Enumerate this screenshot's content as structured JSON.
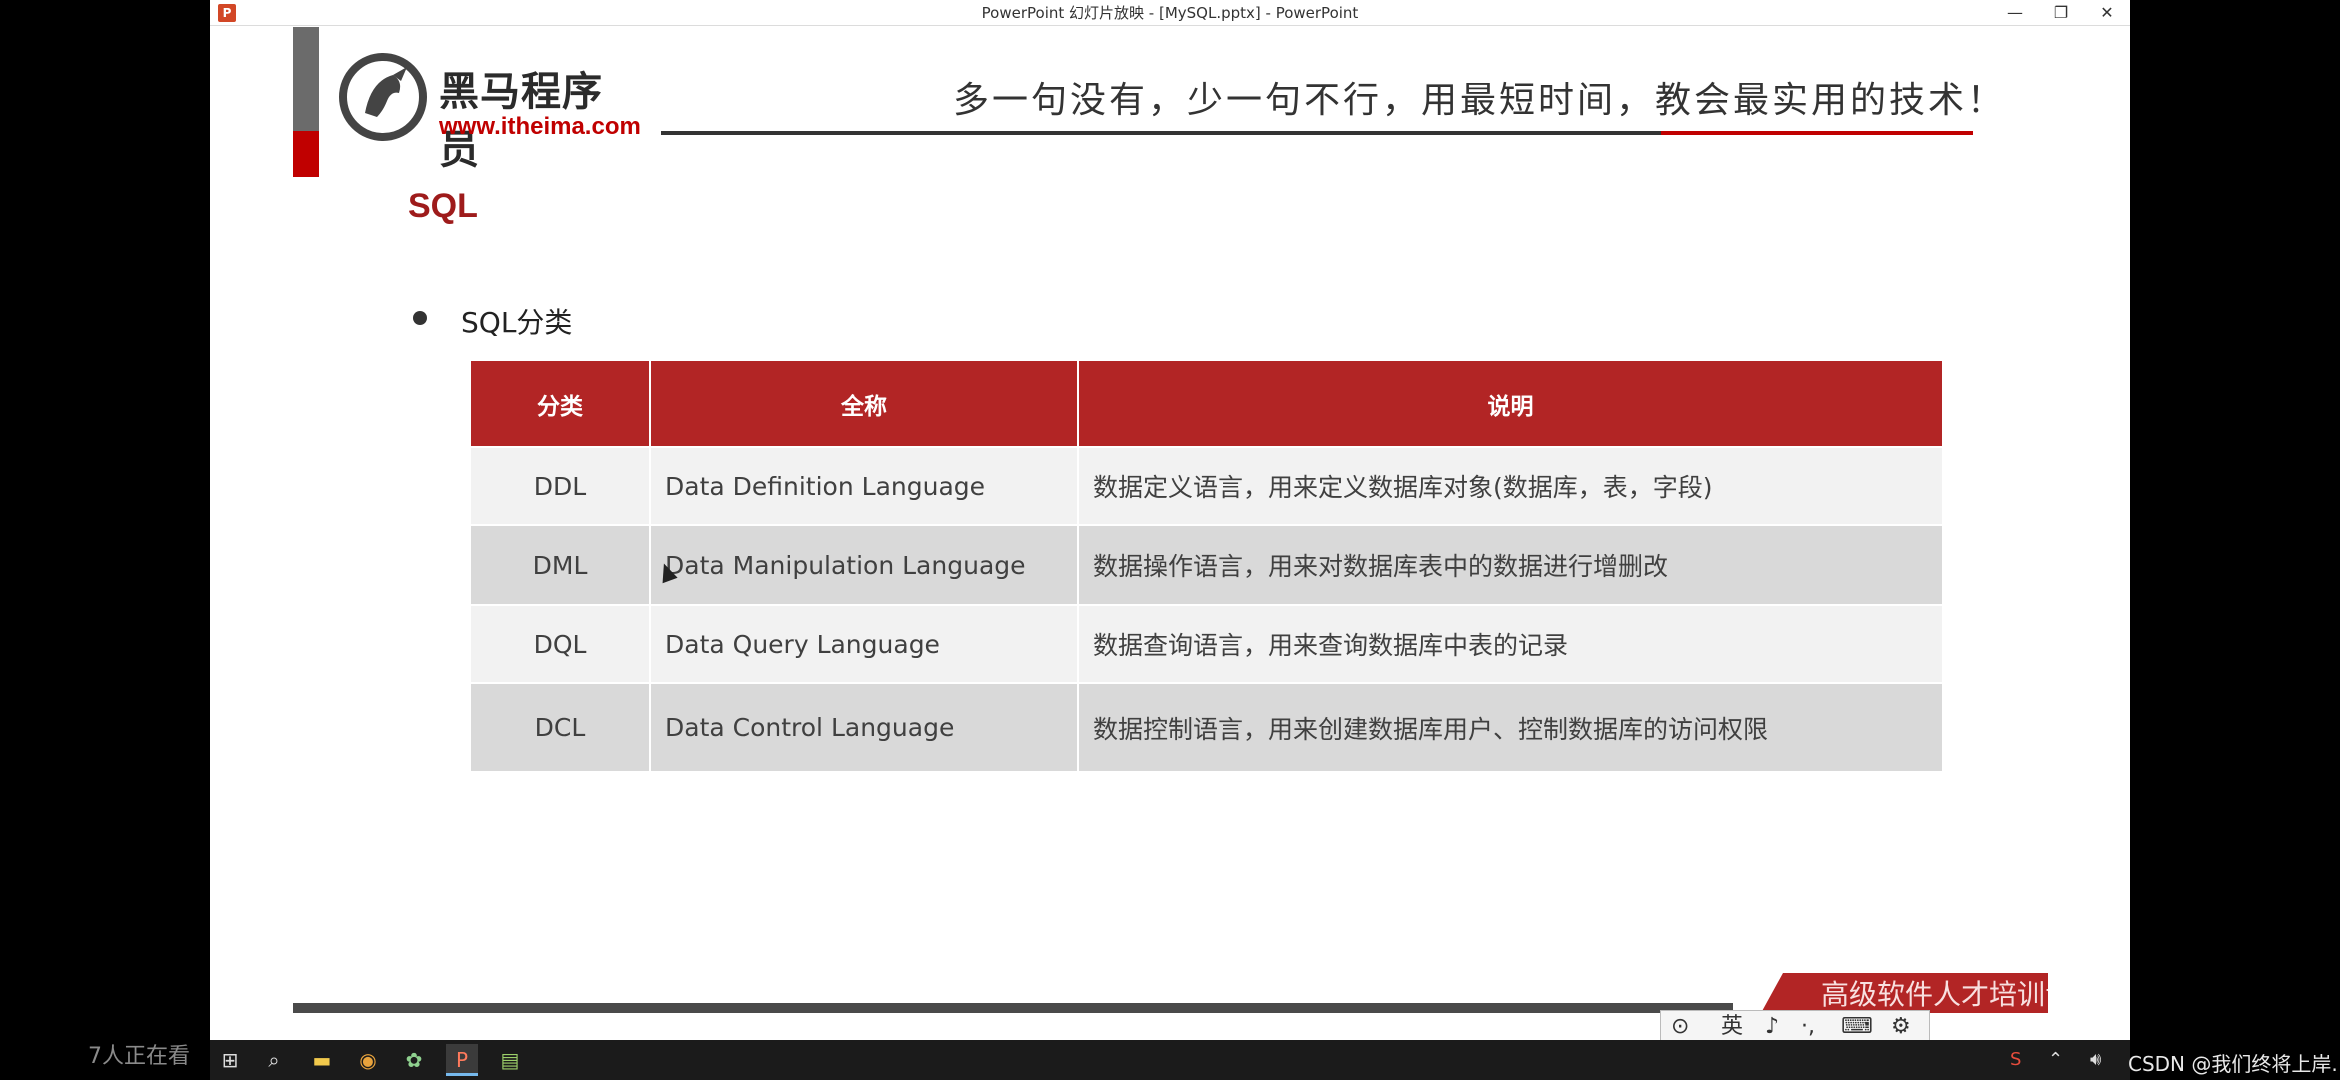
{
  "window": {
    "title": "PowerPoint 幻灯片放映 - [MySQL.pptx] - PowerPoint",
    "app_icon": "P",
    "minimize": "—",
    "maximize": "❐",
    "close": "✕"
  },
  "slide": {
    "logo_cn": "黑马程序员",
    "logo_url": "www.itheima.com",
    "slogan": "多一句没有，少一句不行，用最短时间，教会最实用的技术！",
    "title": "SQL",
    "bullet": "SQL分类",
    "table": {
      "headers": [
        "分类",
        "全称",
        "说明"
      ],
      "rows": [
        {
          "abbr": "DDL",
          "full": "Data Definition Language",
          "desc": "数据定义语言，用来定义数据库对象(数据库，表，字段)"
        },
        {
          "abbr": "DML",
          "full": "Data Manipulation Language",
          "desc": "数据操作语言，用来对数据库表中的数据进行增删改"
        },
        {
          "abbr": "DQL",
          "full": "Data Query Language",
          "desc": "数据查询语言，用来查询数据库中表的记录"
        },
        {
          "abbr": "DCL",
          "full": "Data Control Language",
          "desc": "数据控制语言，用来创建数据库用户、控制数据库的访问权限"
        }
      ]
    },
    "banner_text": "高级软件人才培训专家"
  },
  "controls": {
    "ime_lang": "英",
    "icons": [
      "ime-icon",
      "microphone-icon",
      "keyboard-icon",
      "settings-icon"
    ]
  },
  "taskbar": {
    "icons": [
      "windows-start-icon",
      "search-icon",
      "file-explorer-icon",
      "chrome-icon",
      "app-icon",
      "powerpoint-icon",
      "notepad-icon"
    ]
  },
  "overlay": {
    "viewer_count": "7人正在看",
    "watermark": "CSDN @我们终将上岸."
  }
}
